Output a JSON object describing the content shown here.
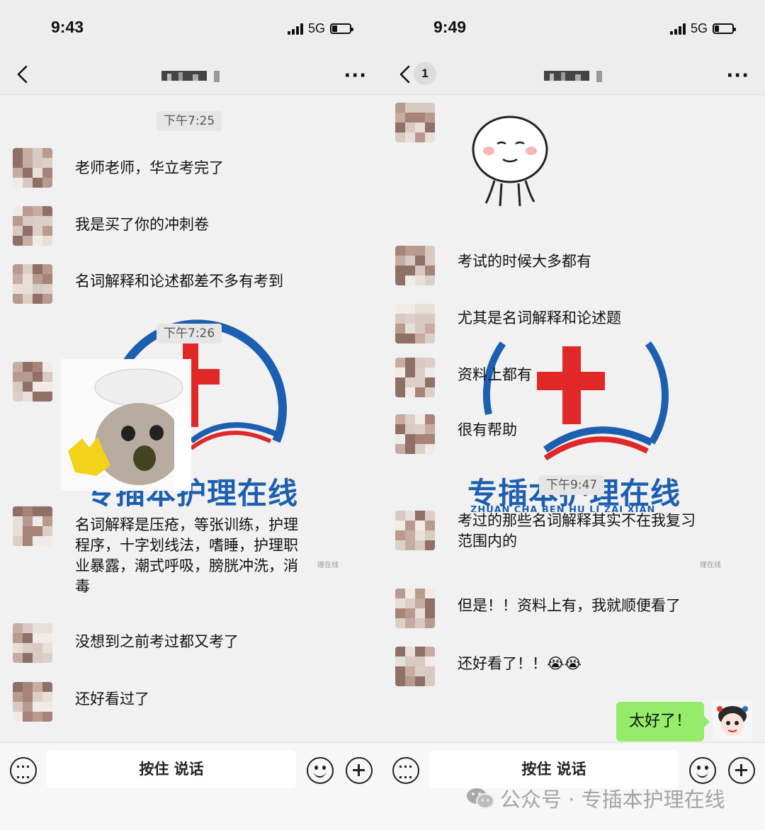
{
  "left": {
    "status": {
      "time": "9:43",
      "network": "5G"
    },
    "timestamps": [
      "下午7:25",
      "下午7:26"
    ],
    "messages": [
      "老师老师，华立考完了",
      "我是买了你的冲刺卷",
      "名词解释和论述都差不多有考到",
      "名词解释是压疮，等张训练，护理程序，十字划线法，嗜睡，护理职业暴露，潮式呼吸，膀胱冲洗，消毒",
      "没想到之前考过都又考了",
      "还好看过了"
    ],
    "input": {
      "talk_label": "按住 说话"
    },
    "logo_text": "专插本护理在线",
    "watermark": "理在线"
  },
  "right": {
    "status": {
      "time": "9:49",
      "network": "5G"
    },
    "unread_count": "1",
    "timestamps": [
      "下午9:47"
    ],
    "messages": [
      "考试的时候大多都有",
      "尤其是名词解释和论述题",
      "资料上都有",
      "很有帮助",
      "考过的那些名词解释其实不在我复习范围内的",
      "但是！！资料上有，我就顺便看了",
      "还好看了！！😭😭"
    ],
    "my_message": "太好了！",
    "input": {
      "talk_label": "按住 说话"
    },
    "logo_text": "专插本护理在线",
    "logo_pinyin": "ZHUAN CHA BEN HU LI ZAI XIAN",
    "watermark": "理在线"
  },
  "footer_watermark": "公众号 · 专插本护理在线",
  "icons": [
    "back-icon",
    "more-icon",
    "keyboard-icon",
    "emoji-icon",
    "plus-icon",
    "wechat-icon"
  ],
  "colors": {
    "bubble_mine": "#95ec69",
    "chat_bg": "#f1f1f1",
    "logo_blue": "#1c5fb0",
    "logo_red": "#e02828"
  }
}
